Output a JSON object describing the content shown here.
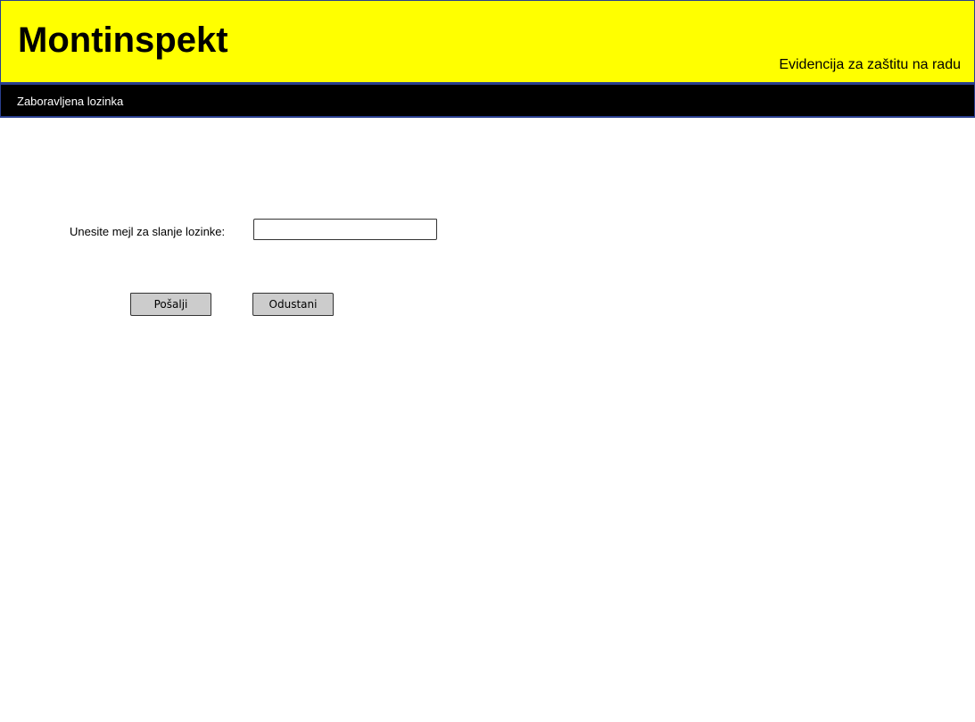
{
  "header": {
    "brand": "Montinspekt",
    "tagline": "Evidencija za zaštitu na radu",
    "background_color": "#ffff00",
    "border_color": "#2a3f8f"
  },
  "navbar": {
    "title": "Zaboravljena lozinka"
  },
  "form": {
    "email_label": "Unesite mejl za slanje lozinke:",
    "email_value": "",
    "email_placeholder": "",
    "send_label": "Pošalji",
    "cancel_label": "Odustani"
  }
}
